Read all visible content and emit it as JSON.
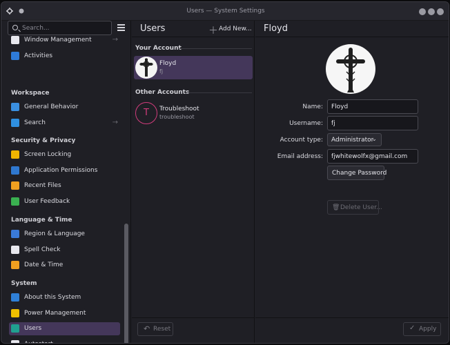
{
  "window": {
    "title": "Users — System Settings"
  },
  "sidebar": {
    "search_placeholder": "Search...",
    "sections": [
      {
        "heading": "",
        "items": [
          {
            "label": "Window Management",
            "icon": "window-management-icon",
            "color": "#e8e8ee",
            "arrow": true
          },
          {
            "label": "Activities",
            "icon": "activities-icon",
            "color": "#2e7bd8",
            "arrow": false
          }
        ]
      },
      {
        "heading": "Workspace",
        "items": [
          {
            "label": "General Behavior",
            "icon": "general-behavior-icon",
            "color": "#3a8fe0",
            "arrow": false
          },
          {
            "label": "Search",
            "icon": "search-icon",
            "color": "#2f90e0",
            "arrow": true
          }
        ]
      },
      {
        "heading": "Security & Privacy",
        "items": [
          {
            "label": "Screen Locking",
            "icon": "lock-icon",
            "color": "#f0b400",
            "arrow": false
          },
          {
            "label": "Application Permissions",
            "icon": "permissions-icon",
            "color": "#2f78d0",
            "arrow": false
          },
          {
            "label": "Recent Files",
            "icon": "recent-files-icon",
            "color": "#f0a020",
            "arrow": false
          },
          {
            "label": "User Feedback",
            "icon": "user-feedback-icon",
            "color": "#3ab050",
            "arrow": false
          }
        ]
      },
      {
        "heading": "Language & Time",
        "items": [
          {
            "label": "Region & Language",
            "icon": "region-language-icon",
            "color": "#3a7ad8",
            "arrow": false
          },
          {
            "label": "Spell Check",
            "icon": "spell-check-icon",
            "color": "#e8e8ee",
            "arrow": false
          },
          {
            "label": "Date & Time",
            "icon": "clock-icon",
            "color": "#f0a020",
            "arrow": false
          }
        ]
      },
      {
        "heading": "System",
        "items": [
          {
            "label": "About this System",
            "icon": "info-icon",
            "color": "#2f80d8",
            "arrow": false
          },
          {
            "label": "Power Management",
            "icon": "power-icon",
            "color": "#f0c000",
            "arrow": false
          },
          {
            "label": "Users",
            "icon": "users-icon",
            "color": "#20a090",
            "arrow": false,
            "active": true
          },
          {
            "label": "Autostart",
            "icon": "autostart-icon",
            "color": "#e8e8ee",
            "arrow": false
          }
        ]
      }
    ]
  },
  "users_panel": {
    "title": "Users",
    "add_new_label": "Add New...",
    "your_account_heading": "Your Account",
    "other_accounts_heading": "Other Accounts",
    "accounts": [
      {
        "name": "Floyd",
        "username": "fj",
        "active": true,
        "avatar": "cross-avatar"
      },
      {
        "name": "Troubleshoot",
        "username": "troubleshoot",
        "active": false,
        "avatar": "letter",
        "letter": "T"
      }
    ],
    "reset_label": "Reset"
  },
  "detail": {
    "title": "Floyd",
    "name_label": "Name:",
    "name_value": "Floyd",
    "username_label": "Username:",
    "username_value": "fj",
    "account_type_label": "Account type:",
    "account_type_value": "Administrator",
    "email_label": "Email address:",
    "email_value": "fjwhitewolfx@gmail.com",
    "change_password_label": "Change Password",
    "delete_user_label": "Delete User...",
    "apply_label": "Apply"
  },
  "colors": {
    "accent": "#44375a",
    "background": "#1f1f25",
    "letter_avatar": "#d23c7c"
  }
}
